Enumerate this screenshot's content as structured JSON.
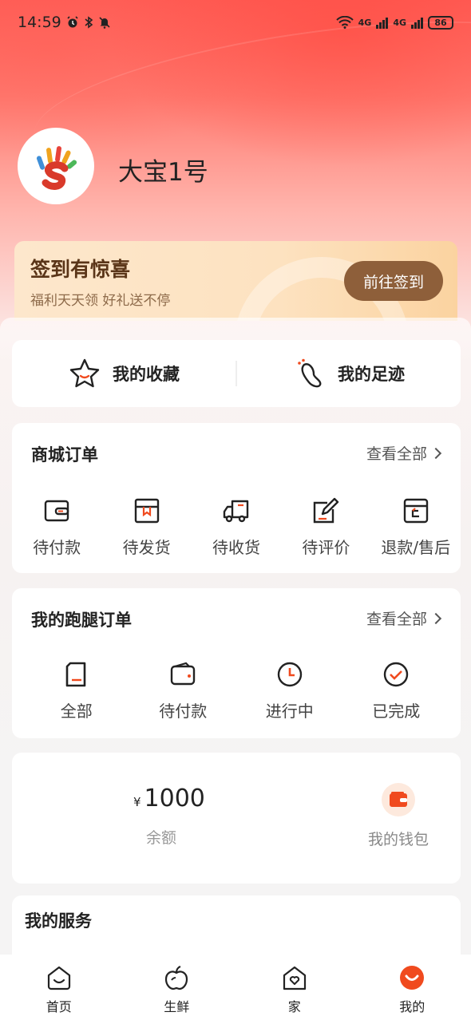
{
  "status_bar": {
    "time": "14:59",
    "network_1": "4G",
    "network_2": "4G",
    "battery": "86"
  },
  "profile": {
    "username": "大宝1号"
  },
  "signin_banner": {
    "title": "签到有惊喜",
    "subtitle": "福利天天领 好礼送不停",
    "button": "前往签到"
  },
  "quick_links": [
    {
      "label": "我的收藏",
      "icon": "star-icon"
    },
    {
      "label": "我的足迹",
      "icon": "footprint-icon"
    }
  ],
  "mall_orders": {
    "title": "商城订单",
    "view_all": "查看全部",
    "items": [
      {
        "label": "待付款",
        "icon": "wallet-icon"
      },
      {
        "label": "待发货",
        "icon": "package-icon"
      },
      {
        "label": "待收货",
        "icon": "truck-icon"
      },
      {
        "label": "待评价",
        "icon": "edit-icon"
      },
      {
        "label": "退款/售后",
        "icon": "refund-icon"
      }
    ]
  },
  "errand_orders": {
    "title": "我的跑腿订单",
    "view_all": "查看全部",
    "items": [
      {
        "label": "全部",
        "icon": "document-icon"
      },
      {
        "label": "待付款",
        "icon": "wallet-icon"
      },
      {
        "label": "进行中",
        "icon": "clock-icon"
      },
      {
        "label": "已完成",
        "icon": "check-circle-icon"
      }
    ]
  },
  "balance": {
    "currency": "¥",
    "amount": "1000",
    "label": "余额",
    "wallet_label": "我的钱包"
  },
  "services": {
    "title": "我的服务"
  },
  "bottom_nav": [
    {
      "label": "首页",
      "icon": "home-icon"
    },
    {
      "label": "生鲜",
      "icon": "apple-icon"
    },
    {
      "label": "家",
      "icon": "house-heart-icon"
    },
    {
      "label": "我的",
      "icon": "smile-icon",
      "active": true
    }
  ],
  "colors": {
    "accent": "#f04a1e",
    "brand_red": "#ff5e57",
    "signin_button": "#8e5f3a"
  }
}
